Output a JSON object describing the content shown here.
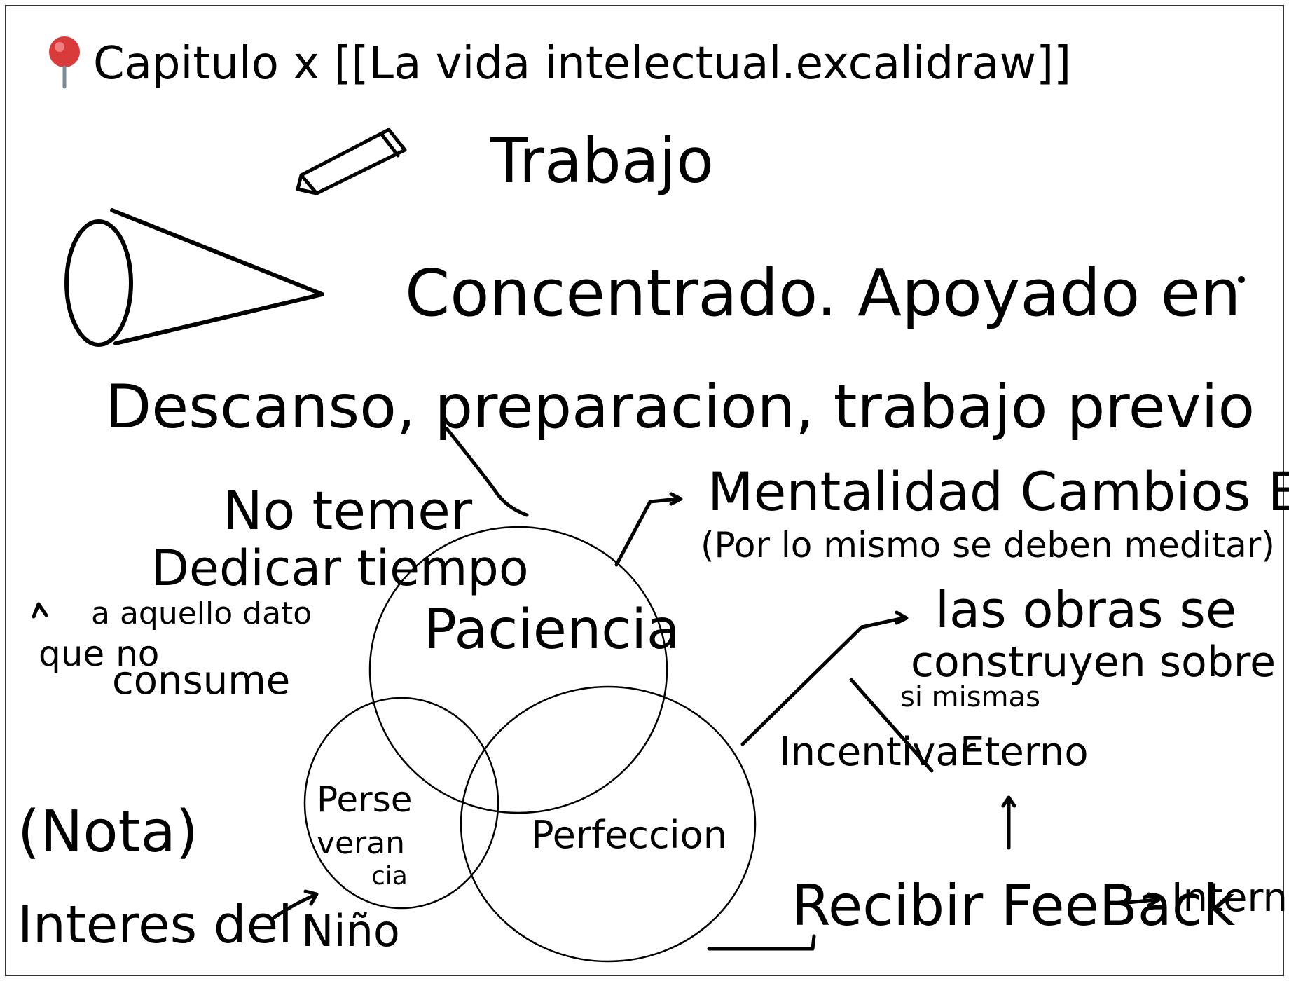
{
  "title": {
    "pin_icon": "pushpin-icon",
    "text": "Capitulo x [[La vida intelectual.excalidraw]]"
  },
  "notes": {
    "trabajo": "Trabajo",
    "concentrado": "Concentrado. Apoyado en",
    "descanso": "Descanso, preparacion, trabajo previo",
    "no_temer": "No temer",
    "dedicar_tiempo": "Dedicar tiempo",
    "aquello": "a aquello dato",
    "que_no": "que no",
    "consume": "consume",
    "mentalidad": "Mentalidad Cambios Eternos",
    "por_lo_mismo": "(Por lo mismo se deben meditar)",
    "las_obras": "las obras se",
    "construyen": "construyen sobre",
    "si_mismas": "si mismas",
    "incentivar": "Incentivar",
    "eterno": "Eterno",
    "recibir": "Recibir FeeBack",
    "interno": "Interno",
    "nota": "(Nota)",
    "interes": "Interes del",
    "nino": "Niño"
  },
  "venn": {
    "paciencia": "Paciencia",
    "perseverancia_1": "Perse",
    "perseverancia_2": "veran",
    "perseverancia_3": "cia",
    "perfeccion": "Perfeccion"
  },
  "colors": {
    "ink": "#000000",
    "background": "#ffffff",
    "frame": "#333333",
    "pin": "#d93a3a"
  }
}
